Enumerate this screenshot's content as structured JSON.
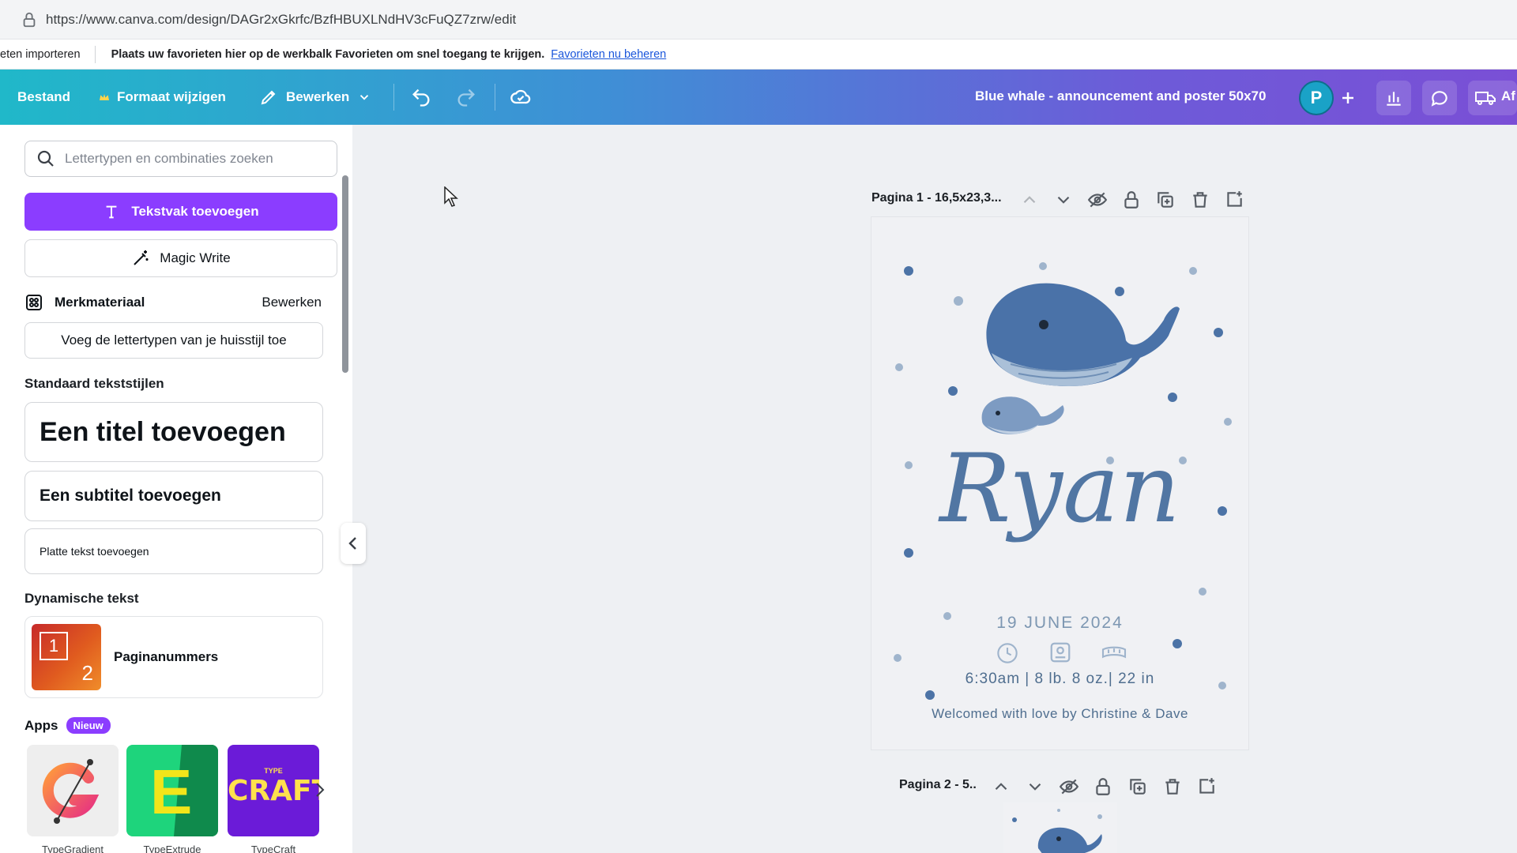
{
  "browser": {
    "url": "https://www.canva.com/design/DAGr2xGkrfc/BzfHBUXLNdHV3cFuQZ7zrw/edit"
  },
  "bookmarks": {
    "import_label": "eten importeren",
    "message": "Plaats uw favorieten hier op de werkbalk Favorieten om snel toegang te krijgen.",
    "manage_link": "Favorieten nu beheren"
  },
  "toolbar": {
    "file": "Bestand",
    "resize": "Formaat wijzigen",
    "edit": "Bewerken",
    "doc_title": "Blue whale - announcement and poster 50x70",
    "avatar_initial": "P",
    "share_partial": "Af"
  },
  "panel": {
    "search_placeholder": "Lettertypen en combinaties zoeken",
    "add_textbox": "Tekstvak toevoegen",
    "magic_write": "Magic Write",
    "brand_heading": "Merkmateriaal",
    "brand_edit": "Bewerken",
    "brand_fonts_button": "Voeg de lettertypen van je huisstijl toe",
    "default_styles_heading": "Standaard tekststijlen",
    "add_title": "Een titel toevoegen",
    "add_subtitle": "Een subtitel toevoegen",
    "add_body": "Platte tekst toevoegen",
    "dynamic_heading": "Dynamische tekst",
    "page_numbers": "Paginanummers",
    "page_number_thumb": [
      "1",
      "2"
    ],
    "apps_heading": "Apps",
    "apps_badge": "Nieuw",
    "apps": [
      {
        "name": "TypeGradient"
      },
      {
        "name": "TypeExtrude"
      },
      {
        "name": "TypeCraft",
        "logo_text": "CRAFT",
        "logo_small": "TYPE"
      }
    ],
    "typeextrude_letter": "E"
  },
  "canvas": {
    "page1_label": "Pagina 1 - 16,5x23,3...",
    "page2_label": "Pagina 2 - 5..",
    "poster": {
      "name": "Ryan",
      "date": "19 JUNE 2024",
      "stats": "6:30am | 8 lb. 8 oz.| 22 in",
      "welcome": "Welcomed with love by Christine & Dave"
    }
  },
  "colors": {
    "accent_purple": "#8b3dff",
    "whale_blue": "#4a72a8",
    "text_blue": "#4f6e8f"
  }
}
